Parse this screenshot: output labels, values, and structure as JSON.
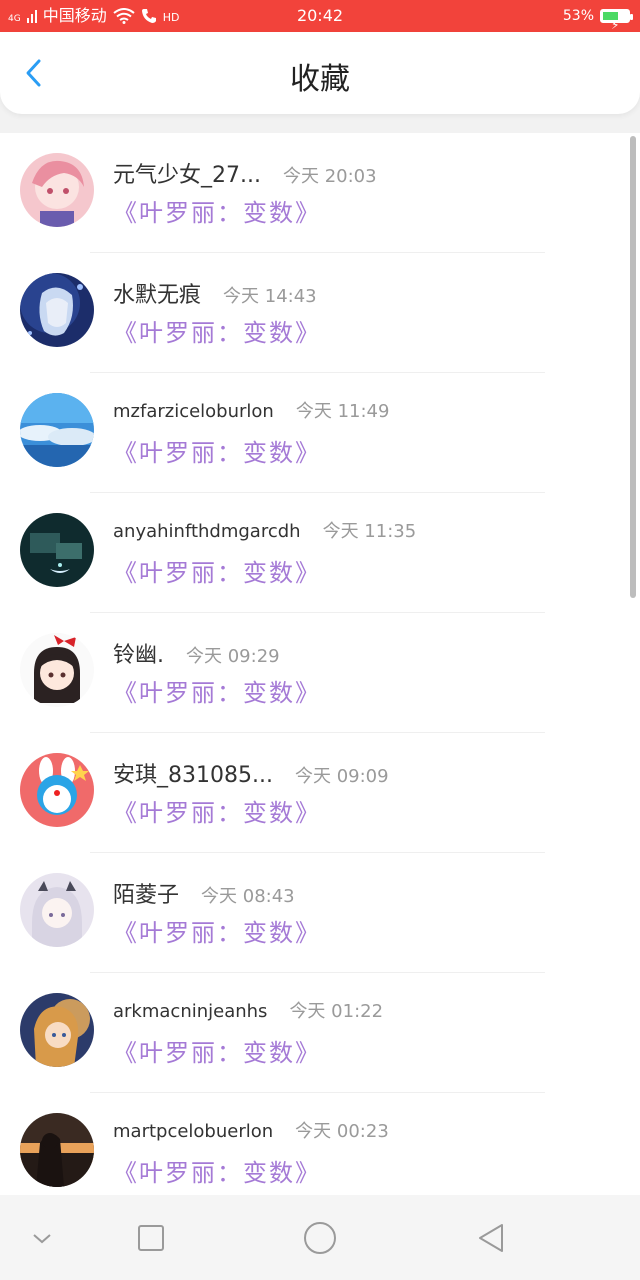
{
  "status_bar": {
    "signal": "4G",
    "carrier": "中国移动",
    "hd": "HD",
    "time": "20:42",
    "battery": "53%",
    "battery_level": 0.53,
    "bg_color": "#f2433b"
  },
  "header": {
    "back_icon": "chevron-left",
    "title": "收藏",
    "accent": "#2a9df4"
  },
  "favorites": [
    {
      "name": "元气少女_27...",
      "time": "今天 20:03",
      "book": "《叶罗丽：变数》"
    },
    {
      "name": "水默无痕",
      "time": "今天 14:43",
      "book": "《叶罗丽：变数》"
    },
    {
      "name": "mzfarziceloburlon",
      "time": "今天 11:49",
      "book": "《叶罗丽：变数》"
    },
    {
      "name": "anyahinfthdmgarcdh",
      "time": "今天 11:35",
      "book": "《叶罗丽：变数》"
    },
    {
      "name": "铃幽.",
      "time": "今天 09:29",
      "book": "《叶罗丽：变数》"
    },
    {
      "name": "安琪_831085...",
      "time": "今天 09:09",
      "book": "《叶罗丽：变数》"
    },
    {
      "name": "陌菱子",
      "time": "今天 08:43",
      "book": "《叶罗丽：变数》"
    },
    {
      "name": "arkmacninjeanhs",
      "time": "今天 01:22",
      "book": "《叶罗丽：变数》"
    },
    {
      "name": "martpcelobuerlon",
      "time": "今天 00:23",
      "book": "《叶罗丽：变数》"
    }
  ],
  "colors": {
    "book_title": "#a57ad6",
    "time": "#9a9a9a"
  },
  "nav": {
    "icons": [
      "chevron-down-icon",
      "square-icon",
      "circle-icon",
      "triangle-back-icon"
    ]
  }
}
